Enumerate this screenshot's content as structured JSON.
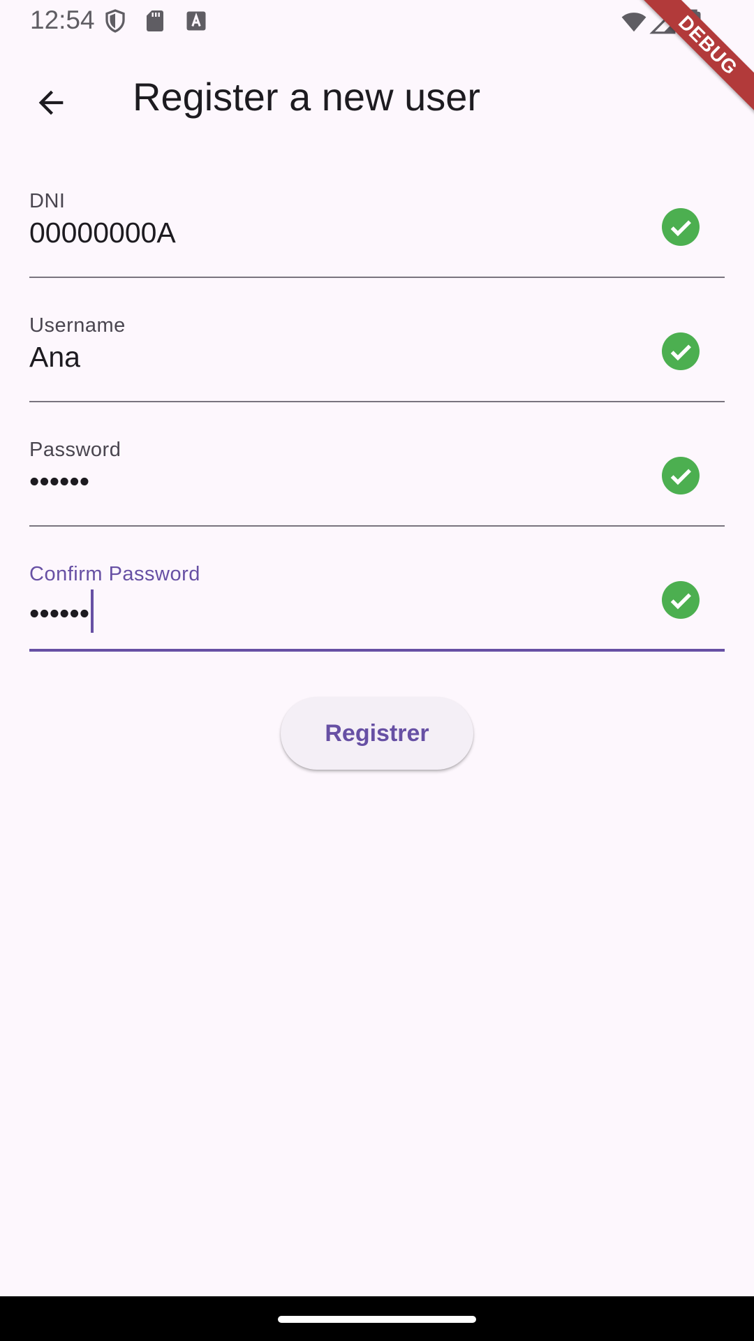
{
  "status_bar": {
    "time": "12:54",
    "icons_left": [
      "shield-icon",
      "sd-card-icon",
      "text-a-icon"
    ],
    "icons_right": [
      "wifi-icon",
      "signal-icon",
      "battery-icon"
    ]
  },
  "debug_ribbon": {
    "label": "DEBUG",
    "color": "#b23a3a"
  },
  "app_bar": {
    "back_icon": "arrow-back-icon",
    "title": "Register a new user"
  },
  "form": {
    "fields": [
      {
        "label": "DNI",
        "value": "00000000A",
        "valid": true
      },
      {
        "label": "Username",
        "value": "Ana",
        "valid": true
      },
      {
        "label": "Password",
        "value": "••••••",
        "valid": true
      },
      {
        "label": "Confirm Password",
        "value": "••••••",
        "valid": true,
        "focused": true
      }
    ],
    "register_label": "Registrer"
  },
  "colors": {
    "accent": "#6750a4",
    "valid": "#4caf50",
    "background": "#fdf7fd",
    "underline": "#79747e"
  }
}
